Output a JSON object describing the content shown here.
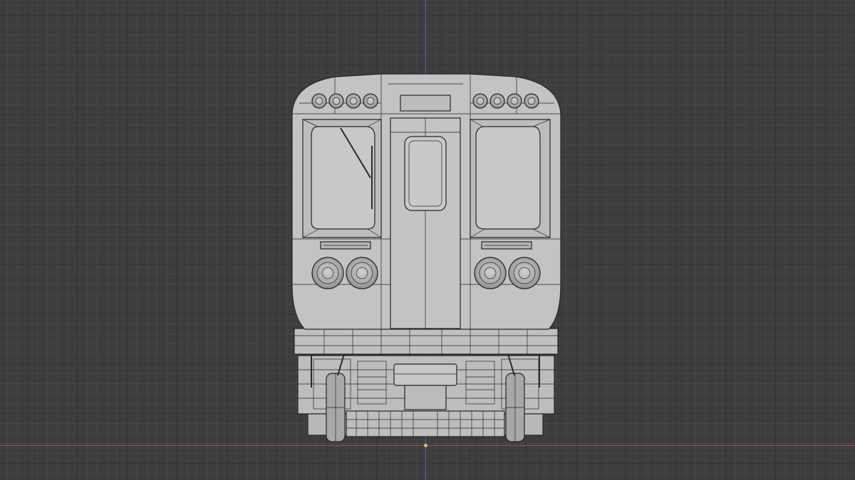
{
  "viewport": {
    "background_color": "#3d3d3d",
    "grid_minor_color": "#474747",
    "grid_major_color": "#333333",
    "y_axis_color": "#5470c8",
    "x_axis_color": "#b04650",
    "origin_color": "#d8c060"
  },
  "model": {
    "name_icon": "train-front-mesh-icon",
    "body_color": "#c3c3c3",
    "shade_color": "#b3b3b3",
    "wire_color": "#262626",
    "headlights": 4,
    "top_lights_per_side": 4
  }
}
